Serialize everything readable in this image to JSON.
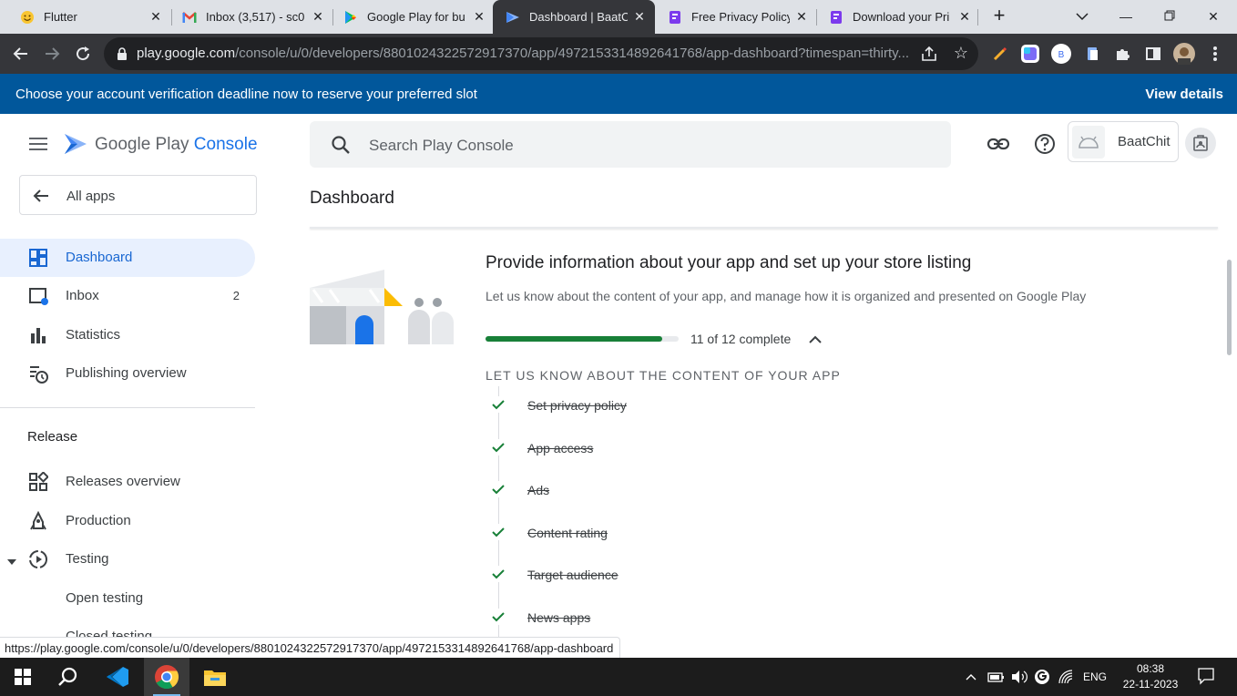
{
  "browser": {
    "tabs": [
      {
        "title": "Flutter",
        "icon": "flutter-emoji-icon"
      },
      {
        "title": "Inbox (3,517) - sc0",
        "icon": "gmail-icon"
      },
      {
        "title": "Google Play for bu",
        "icon": "google-play-icon"
      },
      {
        "title": "Dashboard | BaatC",
        "icon": "play-console-icon",
        "active": true
      },
      {
        "title": "Free Privacy Policy",
        "icon": "privacy-policy-icon"
      },
      {
        "title": "Download your Pri",
        "icon": "privacy-policy-icon"
      }
    ],
    "new_tab": "+",
    "url_host": "play.google.com",
    "url_path": "/console/u/0/developers/8801024322572917370/app/4972153314892641768/app-dashboard?timespan=thirty..."
  },
  "banner": {
    "text": "Choose your account verification deadline now to reserve your preferred slot",
    "link": "View details"
  },
  "sidebar": {
    "logo_prefix": "Google Play ",
    "logo_accent": "Console",
    "all_apps": "All apps",
    "items": [
      {
        "label": "Dashboard",
        "icon": "dashboard-icon",
        "active": true
      },
      {
        "label": "Inbox",
        "icon": "inbox-icon",
        "count": "2"
      },
      {
        "label": "Statistics",
        "icon": "statistics-icon"
      },
      {
        "label": "Publishing overview",
        "icon": "publishing-overview-icon"
      }
    ],
    "section": "Release",
    "release_items": [
      {
        "label": "Releases overview",
        "icon": "releases-overview-icon"
      },
      {
        "label": "Production",
        "icon": "production-icon"
      },
      {
        "label": "Testing",
        "icon": "testing-icon"
      },
      {
        "label": "Open testing"
      },
      {
        "label": "Closed testing"
      }
    ]
  },
  "header": {
    "search_placeholder": "Search Play Console",
    "app_name": "BaatChit"
  },
  "main": {
    "page_title": "Dashboard",
    "task": {
      "title": "Provide information about your app and set up your store listing",
      "description": "Let us know about the content of your app, and manage how it is organized and presented on Google Play",
      "progress_label": "11 of 12 complete",
      "progress_fraction": 0.917,
      "section_title": "LET US KNOW ABOUT THE CONTENT OF YOUR APP",
      "items": [
        "Set privacy policy",
        "App access",
        "Ads",
        "Content rating",
        "Target audience",
        "News apps"
      ]
    }
  },
  "status_url": "https://play.google.com/console/u/0/developers/8801024322572917370/app/4972153314892641768/app-dashboard",
  "taskbar": {
    "language": "ENG",
    "time": "08:38",
    "date": "22-11-2023"
  },
  "colors": {
    "banner": "#01579b",
    "accent": "#1a73e8",
    "progress": "#188038"
  }
}
